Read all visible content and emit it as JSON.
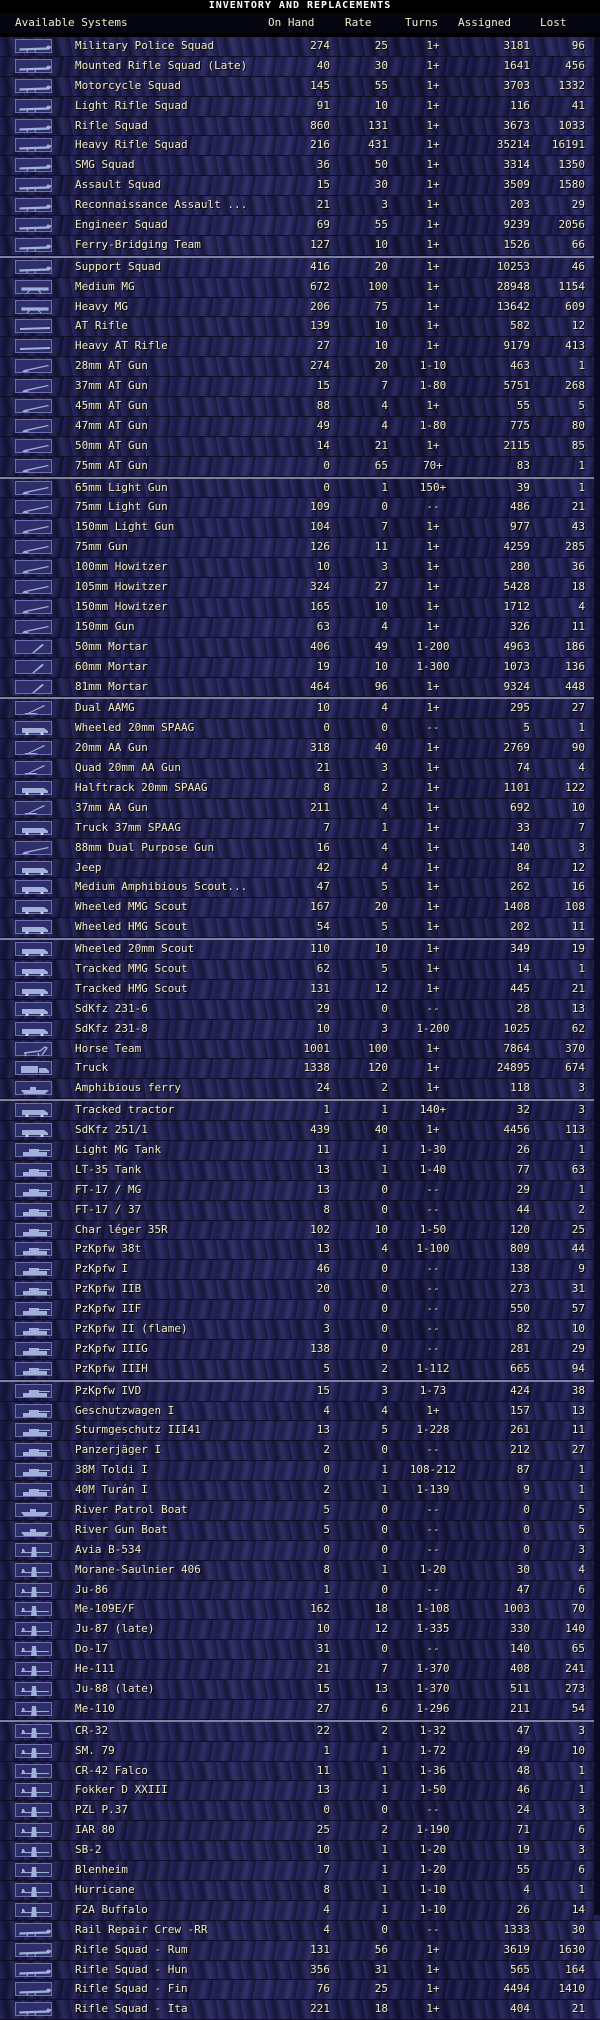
{
  "window": {
    "title": "INVENTORY AND REPLACEMENTS"
  },
  "header": {
    "systems": "Available Systems",
    "on_hand": "On Hand",
    "rate": "Rate",
    "turns": "Turns",
    "assigned": "Assigned",
    "lost": "Lost"
  },
  "colors": {
    "text": "#f4ecc8",
    "icon_border": "#7070b0",
    "row_blue": "#2a2a5e"
  },
  "rows": [
    {
      "name": "Military Police Squad",
      "on_hand": "274",
      "rate": "25",
      "turns": "1+",
      "assigned": "3181",
      "lost": "96",
      "icon": "infantry-icon"
    },
    {
      "name": "Mounted Rifle Squad (Late)",
      "on_hand": "40",
      "rate": "30",
      "turns": "1+",
      "assigned": "1641",
      "lost": "456",
      "icon": "infantry-icon"
    },
    {
      "name": "Motorcycle Squad",
      "on_hand": "145",
      "rate": "55",
      "turns": "1+",
      "assigned": "3703",
      "lost": "1332",
      "icon": "infantry-icon"
    },
    {
      "name": "Light Rifle Squad",
      "on_hand": "91",
      "rate": "10",
      "turns": "1+",
      "assigned": "116",
      "lost": "41",
      "icon": "infantry-icon"
    },
    {
      "name": "Rifle Squad",
      "on_hand": "860",
      "rate": "131",
      "turns": "1+",
      "assigned": "3673",
      "lost": "1033",
      "icon": "infantry-icon"
    },
    {
      "name": "Heavy Rifle Squad",
      "on_hand": "216",
      "rate": "431",
      "turns": "1+",
      "assigned": "35214",
      "lost": "16191",
      "icon": "infantry-icon"
    },
    {
      "name": "SMG Squad",
      "on_hand": "36",
      "rate": "50",
      "turns": "1+",
      "assigned": "3314",
      "lost": "1350",
      "icon": "infantry-icon"
    },
    {
      "name": "Assault Squad",
      "on_hand": "15",
      "rate": "30",
      "turns": "1+",
      "assigned": "3509",
      "lost": "1580",
      "icon": "infantry-icon"
    },
    {
      "name": "Reconnaissance Assault ...",
      "on_hand": "21",
      "rate": "3",
      "turns": "1+",
      "assigned": "203",
      "lost": "29",
      "icon": "infantry-icon"
    },
    {
      "name": "Engineer Squad",
      "on_hand": "69",
      "rate": "55",
      "turns": "1+",
      "assigned": "9239",
      "lost": "2056",
      "icon": "infantry-icon"
    },
    {
      "name": "Ferry-Bridging Team",
      "on_hand": "127",
      "rate": "10",
      "turns": "1+",
      "assigned": "1526",
      "lost": "66",
      "icon": "infantry-icon"
    },
    {
      "name": "Support Squad",
      "on_hand": "416",
      "rate": "20",
      "turns": "1+",
      "assigned": "10253",
      "lost": "46",
      "icon": "infantry-icon",
      "sep": true
    },
    {
      "name": "Medium MG",
      "on_hand": "672",
      "rate": "100",
      "turns": "1+",
      "assigned": "28948",
      "lost": "1154",
      "icon": "mg-icon"
    },
    {
      "name": "Heavy MG",
      "on_hand": "206",
      "rate": "75",
      "turns": "1+",
      "assigned": "13642",
      "lost": "609",
      "icon": "mg-icon"
    },
    {
      "name": "AT Rifle",
      "on_hand": "139",
      "rate": "10",
      "turns": "1+",
      "assigned": "582",
      "lost": "12",
      "icon": "rifle-icon"
    },
    {
      "name": "Heavy AT Rifle",
      "on_hand": "27",
      "rate": "10",
      "turns": "1+",
      "assigned": "9179",
      "lost": "413",
      "icon": "rifle-icon"
    },
    {
      "name": "28mm AT Gun",
      "on_hand": "274",
      "rate": "20",
      "turns": "1-10",
      "assigned": "463",
      "lost": "1",
      "icon": "gun-icon"
    },
    {
      "name": "37mm AT Gun",
      "on_hand": "15",
      "rate": "7",
      "turns": "1-80",
      "assigned": "5751",
      "lost": "268",
      "icon": "gun-icon"
    },
    {
      "name": "45mm AT Gun",
      "on_hand": "88",
      "rate": "4",
      "turns": "1+",
      "assigned": "55",
      "lost": "5",
      "icon": "gun-icon"
    },
    {
      "name": "47mm AT Gun",
      "on_hand": "49",
      "rate": "4",
      "turns": "1-80",
      "assigned": "775",
      "lost": "80",
      "icon": "gun-icon"
    },
    {
      "name": "50mm AT Gun",
      "on_hand": "14",
      "rate": "21",
      "turns": "1+",
      "assigned": "2115",
      "lost": "85",
      "icon": "gun-icon"
    },
    {
      "name": "75mm AT Gun",
      "on_hand": "0",
      "rate": "65",
      "turns": "70+",
      "assigned": "83",
      "lost": "1",
      "icon": "gun-icon"
    },
    {
      "name": "65mm Light Gun",
      "on_hand": "0",
      "rate": "1",
      "turns": "150+",
      "assigned": "39",
      "lost": "1",
      "icon": "gun-icon",
      "sep": true
    },
    {
      "name": "75mm Light Gun",
      "on_hand": "109",
      "rate": "0",
      "turns": "--",
      "assigned": "486",
      "lost": "21",
      "icon": "gun-icon"
    },
    {
      "name": "150mm Light Gun",
      "on_hand": "104",
      "rate": "7",
      "turns": "1+",
      "assigned": "977",
      "lost": "43",
      "icon": "gun-icon"
    },
    {
      "name": "75mm Gun",
      "on_hand": "126",
      "rate": "11",
      "turns": "1+",
      "assigned": "4259",
      "lost": "285",
      "icon": "gun-icon"
    },
    {
      "name": "100mm Howitzer",
      "on_hand": "10",
      "rate": "3",
      "turns": "1+",
      "assigned": "280",
      "lost": "36",
      "icon": "gun-icon"
    },
    {
      "name": "105mm Howitzer",
      "on_hand": "324",
      "rate": "27",
      "turns": "1+",
      "assigned": "5428",
      "lost": "18",
      "icon": "gun-icon"
    },
    {
      "name": "150mm Howitzer",
      "on_hand": "165",
      "rate": "10",
      "turns": "1+",
      "assigned": "1712",
      "lost": "4",
      "icon": "gun-icon"
    },
    {
      "name": "150mm Gun",
      "on_hand": "63",
      "rate": "4",
      "turns": "1+",
      "assigned": "326",
      "lost": "11",
      "icon": "gun-icon"
    },
    {
      "name": "50mm Mortar",
      "on_hand": "406",
      "rate": "49",
      "turns": "1-200",
      "assigned": "4963",
      "lost": "186",
      "icon": "mortar-icon"
    },
    {
      "name": "60mm Mortar",
      "on_hand": "19",
      "rate": "10",
      "turns": "1-300",
      "assigned": "1073",
      "lost": "136",
      "icon": "mortar-icon"
    },
    {
      "name": "81mm Mortar",
      "on_hand": "464",
      "rate": "96",
      "turns": "1+",
      "assigned": "9324",
      "lost": "448",
      "icon": "mortar-icon"
    },
    {
      "name": "Dual AAMG",
      "on_hand": "10",
      "rate": "4",
      "turns": "1+",
      "assigned": "295",
      "lost": "27",
      "icon": "aa-icon",
      "sep": true
    },
    {
      "name": "Wheeled 20mm SPAAG",
      "on_hand": "0",
      "rate": "0",
      "turns": "--",
      "assigned": "5",
      "lost": "1",
      "icon": "vehicle-icon"
    },
    {
      "name": "20mm AA Gun",
      "on_hand": "318",
      "rate": "40",
      "turns": "1+",
      "assigned": "2769",
      "lost": "90",
      "icon": "aa-icon"
    },
    {
      "name": "Quad 20mm AA Gun",
      "on_hand": "21",
      "rate": "3",
      "turns": "1+",
      "assigned": "74",
      "lost": "4",
      "icon": "aa-icon"
    },
    {
      "name": "Halftrack 20mm SPAAG",
      "on_hand": "8",
      "rate": "2",
      "turns": "1+",
      "assigned": "1101",
      "lost": "122",
      "icon": "vehicle-icon"
    },
    {
      "name": "37mm AA Gun",
      "on_hand": "211",
      "rate": "4",
      "turns": "1+",
      "assigned": "692",
      "lost": "10",
      "icon": "aa-icon"
    },
    {
      "name": "Truck 37mm SPAAG",
      "on_hand": "7",
      "rate": "1",
      "turns": "1+",
      "assigned": "33",
      "lost": "7",
      "icon": "vehicle-icon"
    },
    {
      "name": "88mm Dual Purpose Gun",
      "on_hand": "16",
      "rate": "4",
      "turns": "1+",
      "assigned": "140",
      "lost": "3",
      "icon": "gun-icon"
    },
    {
      "name": "Jeep",
      "on_hand": "42",
      "rate": "4",
      "turns": "1+",
      "assigned": "84",
      "lost": "12",
      "icon": "vehicle-icon"
    },
    {
      "name": "Medium Amphibious Scout...",
      "on_hand": "47",
      "rate": "5",
      "turns": "1+",
      "assigned": "262",
      "lost": "16",
      "icon": "vehicle-icon"
    },
    {
      "name": "Wheeled MMG Scout",
      "on_hand": "167",
      "rate": "20",
      "turns": "1+",
      "assigned": "1408",
      "lost": "108",
      "icon": "vehicle-icon"
    },
    {
      "name": "Wheeled HMG Scout",
      "on_hand": "54",
      "rate": "5",
      "turns": "1+",
      "assigned": "202",
      "lost": "11",
      "icon": "vehicle-icon"
    },
    {
      "name": "Wheeled 20mm Scout",
      "on_hand": "110",
      "rate": "10",
      "turns": "1+",
      "assigned": "349",
      "lost": "19",
      "icon": "vehicle-icon",
      "sep": true
    },
    {
      "name": "Tracked MMG Scout",
      "on_hand": "62",
      "rate": "5",
      "turns": "1+",
      "assigned": "14",
      "lost": "1",
      "icon": "vehicle-icon"
    },
    {
      "name": "Tracked HMG Scout",
      "on_hand": "131",
      "rate": "12",
      "turns": "1+",
      "assigned": "445",
      "lost": "21",
      "icon": "vehicle-icon"
    },
    {
      "name": "SdKfz 231-6",
      "on_hand": "29",
      "rate": "0",
      "turns": "--",
      "assigned": "28",
      "lost": "13",
      "icon": "vehicle-icon"
    },
    {
      "name": "SdKfz 231-8",
      "on_hand": "10",
      "rate": "3",
      "turns": "1-200",
      "assigned": "1025",
      "lost": "62",
      "icon": "vehicle-icon"
    },
    {
      "name": "Horse Team",
      "on_hand": "1001",
      "rate": "100",
      "turns": "1+",
      "assigned": "7864",
      "lost": "370",
      "icon": "horse-icon"
    },
    {
      "name": "Truck",
      "on_hand": "1338",
      "rate": "120",
      "turns": "1+",
      "assigned": "24895",
      "lost": "674",
      "icon": "truck-icon"
    },
    {
      "name": "Amphibious ferry",
      "on_hand": "24",
      "rate": "2",
      "turns": "1+",
      "assigned": "118",
      "lost": "3",
      "icon": "boat-icon"
    },
    {
      "name": "Tracked tractor",
      "on_hand": "1",
      "rate": "1",
      "turns": "140+",
      "assigned": "32",
      "lost": "3",
      "icon": "vehicle-icon",
      "sep": true
    },
    {
      "name": "SdKfz 251/1",
      "on_hand": "439",
      "rate": "40",
      "turns": "1+",
      "assigned": "4456",
      "lost": "113",
      "icon": "vehicle-icon"
    },
    {
      "name": "Light MG Tank",
      "on_hand": "11",
      "rate": "1",
      "turns": "1-30",
      "assigned": "26",
      "lost": "1",
      "icon": "tank-icon"
    },
    {
      "name": "LT-35 Tank",
      "on_hand": "13",
      "rate": "1",
      "turns": "1-40",
      "assigned": "77",
      "lost": "63",
      "icon": "tank-icon"
    },
    {
      "name": "FT-17 / MG",
      "on_hand": "13",
      "rate": "0",
      "turns": "--",
      "assigned": "29",
      "lost": "1",
      "icon": "tank-icon"
    },
    {
      "name": "FT-17 / 37",
      "on_hand": "8",
      "rate": "0",
      "turns": "--",
      "assigned": "44",
      "lost": "2",
      "icon": "tank-icon"
    },
    {
      "name": "Char léger 35R",
      "on_hand": "102",
      "rate": "10",
      "turns": "1-50",
      "assigned": "120",
      "lost": "25",
      "icon": "tank-icon"
    },
    {
      "name": "PzKpfw 38t",
      "on_hand": "13",
      "rate": "4",
      "turns": "1-100",
      "assigned": "809",
      "lost": "44",
      "icon": "tank-icon"
    },
    {
      "name": "PzKpfw I",
      "on_hand": "46",
      "rate": "0",
      "turns": "--",
      "assigned": "138",
      "lost": "9",
      "icon": "tank-icon"
    },
    {
      "name": "PzKpfw IIB",
      "on_hand": "20",
      "rate": "0",
      "turns": "--",
      "assigned": "273",
      "lost": "31",
      "icon": "tank-icon"
    },
    {
      "name": "PzKpfw IIF",
      "on_hand": "0",
      "rate": "0",
      "turns": "--",
      "assigned": "550",
      "lost": "57",
      "icon": "tank-icon"
    },
    {
      "name": "PzKpfw II (flame)",
      "on_hand": "3",
      "rate": "0",
      "turns": "--",
      "assigned": "82",
      "lost": "10",
      "icon": "tank-icon"
    },
    {
      "name": "PzKpfw IIIG",
      "on_hand": "138",
      "rate": "0",
      "turns": "--",
      "assigned": "281",
      "lost": "29",
      "icon": "tank-icon"
    },
    {
      "name": "PzKpfw IIIH",
      "on_hand": "5",
      "rate": "2",
      "turns": "1-112",
      "assigned": "665",
      "lost": "94",
      "icon": "tank-icon"
    },
    {
      "name": "PzKpfw IVD",
      "on_hand": "15",
      "rate": "3",
      "turns": "1-73",
      "assigned": "424",
      "lost": "38",
      "icon": "tank-icon",
      "sep": true
    },
    {
      "name": "Geschutzwagen I",
      "on_hand": "4",
      "rate": "4",
      "turns": "1+",
      "assigned": "157",
      "lost": "13",
      "icon": "tank-icon"
    },
    {
      "name": "Sturmgeschutz III41",
      "on_hand": "13",
      "rate": "5",
      "turns": "1-228",
      "assigned": "261",
      "lost": "11",
      "icon": "tank-icon"
    },
    {
      "name": "Panzerjäger I",
      "on_hand": "2",
      "rate": "0",
      "turns": "--",
      "assigned": "212",
      "lost": "27",
      "icon": "tank-icon"
    },
    {
      "name": "38M Toldi I",
      "on_hand": "0",
      "rate": "1",
      "turns": "108-212",
      "assigned": "87",
      "lost": "1",
      "icon": "tank-icon"
    },
    {
      "name": "40M Turán I",
      "on_hand": "2",
      "rate": "1",
      "turns": "1-139",
      "assigned": "9",
      "lost": "1",
      "icon": "tank-icon"
    },
    {
      "name": "River Patrol Boat",
      "on_hand": "5",
      "rate": "0",
      "turns": "--",
      "assigned": "0",
      "lost": "5",
      "icon": "boat-icon"
    },
    {
      "name": "River Gun Boat",
      "on_hand": "5",
      "rate": "0",
      "turns": "--",
      "assigned": "0",
      "lost": "5",
      "icon": "boat-icon"
    },
    {
      "name": "Avia B-534",
      "on_hand": "0",
      "rate": "0",
      "turns": "--",
      "assigned": "0",
      "lost": "3",
      "icon": "plane-icon"
    },
    {
      "name": "Morane-Saulnier 406",
      "on_hand": "8",
      "rate": "1",
      "turns": "1-20",
      "assigned": "30",
      "lost": "4",
      "icon": "plane-icon"
    },
    {
      "name": "Ju-86",
      "on_hand": "1",
      "rate": "0",
      "turns": "--",
      "assigned": "47",
      "lost": "6",
      "icon": "plane-icon"
    },
    {
      "name": "Me-109E/F",
      "on_hand": "162",
      "rate": "18",
      "turns": "1-108",
      "assigned": "1003",
      "lost": "70",
      "icon": "plane-icon"
    },
    {
      "name": "Ju-87 (late)",
      "on_hand": "10",
      "rate": "12",
      "turns": "1-335",
      "assigned": "330",
      "lost": "140",
      "icon": "plane-icon"
    },
    {
      "name": "Do-17",
      "on_hand": "31",
      "rate": "0",
      "turns": "--",
      "assigned": "140",
      "lost": "65",
      "icon": "plane-icon"
    },
    {
      "name": "He-111",
      "on_hand": "21",
      "rate": "7",
      "turns": "1-370",
      "assigned": "408",
      "lost": "241",
      "icon": "plane-icon"
    },
    {
      "name": "Ju-88 (late)",
      "on_hand": "15",
      "rate": "13",
      "turns": "1-370",
      "assigned": "511",
      "lost": "273",
      "icon": "plane-icon"
    },
    {
      "name": "Me-110",
      "on_hand": "27",
      "rate": "6",
      "turns": "1-296",
      "assigned": "211",
      "lost": "54",
      "icon": "plane-icon"
    },
    {
      "name": "CR-32",
      "on_hand": "22",
      "rate": "2",
      "turns": "1-32",
      "assigned": "47",
      "lost": "3",
      "icon": "plane-icon",
      "sep": true
    },
    {
      "name": "SM. 79",
      "on_hand": "1",
      "rate": "1",
      "turns": "1-72",
      "assigned": "49",
      "lost": "10",
      "icon": "plane-icon"
    },
    {
      "name": "CR-42 Falco",
      "on_hand": "11",
      "rate": "1",
      "turns": "1-36",
      "assigned": "48",
      "lost": "1",
      "icon": "plane-icon"
    },
    {
      "name": "Fokker D XXIII",
      "on_hand": "13",
      "rate": "1",
      "turns": "1-50",
      "assigned": "46",
      "lost": "1",
      "icon": "plane-icon"
    },
    {
      "name": "PZL P.37",
      "on_hand": "0",
      "rate": "0",
      "turns": "--",
      "assigned": "24",
      "lost": "3",
      "icon": "plane-icon"
    },
    {
      "name": "IAR 80",
      "on_hand": "25",
      "rate": "2",
      "turns": "1-190",
      "assigned": "71",
      "lost": "6",
      "icon": "plane-icon"
    },
    {
      "name": "SB-2",
      "on_hand": "10",
      "rate": "1",
      "turns": "1-20",
      "assigned": "19",
      "lost": "3",
      "icon": "plane-icon"
    },
    {
      "name": "Blenheim",
      "on_hand": "7",
      "rate": "1",
      "turns": "1-20",
      "assigned": "55",
      "lost": "6",
      "icon": "plane-icon"
    },
    {
      "name": "Hurricane",
      "on_hand": "8",
      "rate": "1",
      "turns": "1-10",
      "assigned": "4",
      "lost": "1",
      "icon": "plane-icon"
    },
    {
      "name": "F2A Buffalo",
      "on_hand": "4",
      "rate": "1",
      "turns": "1-10",
      "assigned": "26",
      "lost": "14",
      "icon": "plane-icon"
    },
    {
      "name": "Rail Repair Crew -RR",
      "on_hand": "4",
      "rate": "0",
      "turns": "--",
      "assigned": "1333",
      "lost": "30",
      "icon": "infantry-icon"
    },
    {
      "name": "Rifle Squad - Rum",
      "on_hand": "131",
      "rate": "56",
      "turns": "1+",
      "assigned": "3619",
      "lost": "1630",
      "icon": "infantry-icon"
    },
    {
      "name": "Rifle Squad - Hun",
      "on_hand": "356",
      "rate": "31",
      "turns": "1+",
      "assigned": "565",
      "lost": "164",
      "icon": "infantry-icon"
    },
    {
      "name": "Rifle Squad - Fin",
      "on_hand": "76",
      "rate": "25",
      "turns": "1+",
      "assigned": "4494",
      "lost": "1410",
      "icon": "infantry-icon"
    },
    {
      "name": "Rifle Squad - Ita",
      "on_hand": "221",
      "rate": "18",
      "turns": "1+",
      "assigned": "404",
      "lost": "21",
      "icon": "infantry-icon"
    }
  ]
}
